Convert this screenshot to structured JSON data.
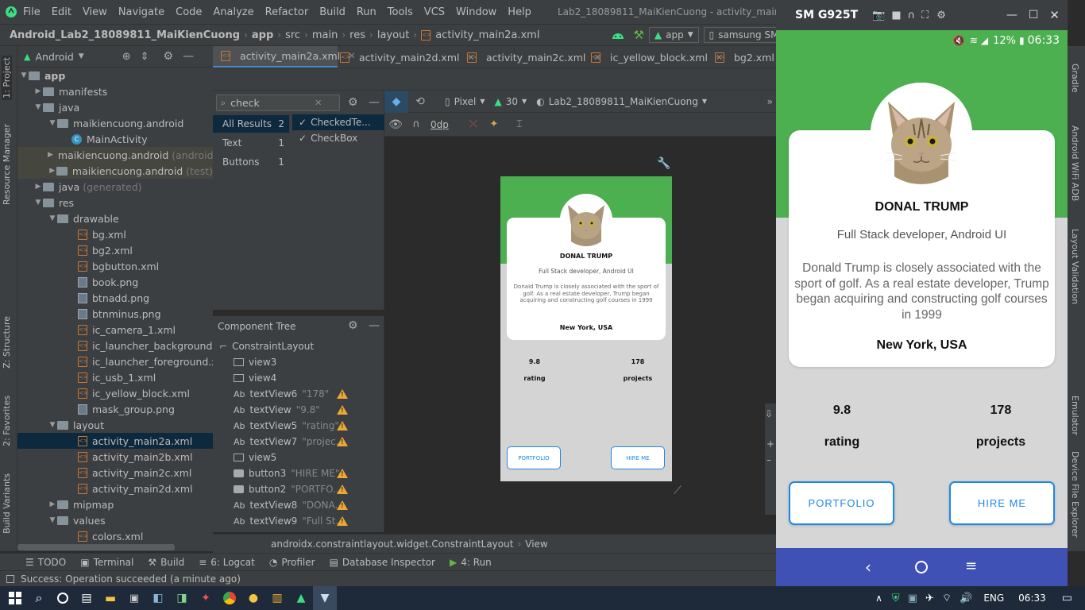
{
  "menu": [
    "File",
    "Edit",
    "View",
    "Navigate",
    "Code",
    "Analyze",
    "Refactor",
    "Build",
    "Run",
    "Tools",
    "VCS",
    "Window",
    "Help"
  ],
  "window_title": "Lab2_18089811_MaiKienCuong - activity_main2a.xml [Lab2_18089811_Mai",
  "breadcrumb": [
    "Android_Lab2_18089811_MaiKienCuong",
    "app",
    "src",
    "main",
    "res",
    "layout",
    "activity_main2a.xml"
  ],
  "run_config": "app",
  "device": "samsung SM-G925T",
  "left_tabs": [
    "1: Project",
    "Resource Manager",
    "Z: Structure",
    "2: Favorites",
    "Build Variants"
  ],
  "project": {
    "view_label": "Android",
    "tree": [
      {
        "label": "app",
        "suffix": "",
        "kind": "folder",
        "arrow": "▼"
      },
      {
        "label": "manifests",
        "suffix": "",
        "kind": "folder",
        "arrow": "▶"
      },
      {
        "label": "java",
        "suffix": "",
        "kind": "folder",
        "arrow": "▼"
      },
      {
        "label": "maikiencuong.android",
        "suffix": "",
        "kind": "folder",
        "arrow": "▼"
      },
      {
        "label": "MainActivity",
        "suffix": "",
        "kind": "class",
        "arrow": ""
      },
      {
        "label": "maikiencuong.android",
        "suffix": "(androidT",
        "kind": "folder",
        "arrow": "▶"
      },
      {
        "label": "maikiencuong.android",
        "suffix": "(test)",
        "kind": "folder",
        "arrow": "▶"
      },
      {
        "label": "java",
        "suffix": "(generated)",
        "kind": "folder",
        "arrow": "▶"
      },
      {
        "label": "res",
        "suffix": "",
        "kind": "folder",
        "arrow": "▼"
      },
      {
        "label": "drawable",
        "suffix": "",
        "kind": "folder",
        "arrow": "▼"
      },
      {
        "label": "bg.xml",
        "suffix": "",
        "kind": "xml",
        "arrow": ""
      },
      {
        "label": "bg2.xml",
        "suffix": "",
        "kind": "xml",
        "arrow": ""
      },
      {
        "label": "bgbutton.xml",
        "suffix": "",
        "kind": "xml",
        "arrow": ""
      },
      {
        "label": "book.png",
        "suffix": "",
        "kind": "png",
        "arrow": ""
      },
      {
        "label": "btnadd.png",
        "suffix": "",
        "kind": "png",
        "arrow": ""
      },
      {
        "label": "btnminus.png",
        "suffix": "",
        "kind": "png",
        "arrow": ""
      },
      {
        "label": "ic_camera_1.xml",
        "suffix": "",
        "kind": "xml",
        "arrow": ""
      },
      {
        "label": "ic_launcher_background.xml",
        "suffix": "",
        "kind": "xml",
        "arrow": ""
      },
      {
        "label": "ic_launcher_foreground.xml",
        "suffix": "(",
        "kind": "xml",
        "arrow": ""
      },
      {
        "label": "ic_usb_1.xml",
        "suffix": "",
        "kind": "xml",
        "arrow": ""
      },
      {
        "label": "ic_yellow_block.xml",
        "suffix": "",
        "kind": "xml",
        "arrow": ""
      },
      {
        "label": "mask_group.png",
        "suffix": "",
        "kind": "png",
        "arrow": ""
      },
      {
        "label": "layout",
        "suffix": "",
        "kind": "folder",
        "arrow": "▼"
      },
      {
        "label": "activity_main2a.xml",
        "suffix": "",
        "kind": "xml",
        "arrow": ""
      },
      {
        "label": "activity_main2b.xml",
        "suffix": "",
        "kind": "xml",
        "arrow": ""
      },
      {
        "label": "activity_main2c.xml",
        "suffix": "",
        "kind": "xml",
        "arrow": ""
      },
      {
        "label": "activity_main2d.xml",
        "suffix": "",
        "kind": "xml",
        "arrow": ""
      },
      {
        "label": "mipmap",
        "suffix": "",
        "kind": "folder",
        "arrow": "▶"
      },
      {
        "label": "values",
        "suffix": "",
        "kind": "folder",
        "arrow": "▼"
      },
      {
        "label": "colors.xml",
        "suffix": "",
        "kind": "xml",
        "arrow": ""
      }
    ]
  },
  "tabs": [
    "activity_main2a.xml",
    "activity_main2d.xml",
    "activity_main2c.xml",
    "ic_yellow_block.xml",
    "bg2.xml"
  ],
  "palette": {
    "search_value": "check",
    "categories": [
      {
        "label": "All Results",
        "count": "2"
      },
      {
        "label": "Text",
        "count": "1"
      },
      {
        "label": "Buttons",
        "count": "1"
      }
    ],
    "results": [
      "CheckedTe...",
      "CheckBox"
    ]
  },
  "component_tree": {
    "title": "Component Tree",
    "root": "ConstraintLayout",
    "nodes": [
      {
        "name": "view3",
        "value": "",
        "kind": "view",
        "warn": false
      },
      {
        "name": "view4",
        "value": "",
        "kind": "view",
        "warn": false
      },
      {
        "name": "textView6",
        "value": "\"178\"",
        "kind": "text",
        "warn": true
      },
      {
        "name": "textView",
        "value": "\"9.8\"",
        "kind": "text",
        "warn": true
      },
      {
        "name": "textView5",
        "value": "\"rating\"",
        "kind": "text",
        "warn": true
      },
      {
        "name": "textView7",
        "value": "\"projec...",
        "kind": "text",
        "warn": true
      },
      {
        "name": "view5",
        "value": "",
        "kind": "view",
        "warn": false
      },
      {
        "name": "button3",
        "value": "\"HIRE ME\"",
        "kind": "button",
        "warn": true
      },
      {
        "name": "button2",
        "value": "\"PORTFO...",
        "kind": "button",
        "warn": true
      },
      {
        "name": "textView8",
        "value": "\"DONA...",
        "kind": "text",
        "warn": true
      },
      {
        "name": "textView9",
        "value": "\"Full St...",
        "kind": "text",
        "warn": true
      }
    ]
  },
  "design_toolbar": {
    "device": "Pixel",
    "api": "30",
    "theme": "Lab2_18089811_MaiKienCuong",
    "margin": "0dp"
  },
  "layout_breadcrumb": [
    "androidx.constraintlayout.widget.ConstraintLayout",
    "View"
  ],
  "profile": {
    "name": "DONAL TRUMP",
    "role": "Full Stack developer, Android UI",
    "bio": "Donald Trump is closely associated with the sport of golf. As a real estate developer, Trump began acquiring and constructing golf courses in 1999",
    "location": "New York, USA",
    "rating_value": "9.8",
    "rating_label": "rating",
    "projects_value": "178",
    "projects_label": "projects",
    "btn_portfolio": "PORTFOLIO",
    "btn_hire": "HIRE ME"
  },
  "tool_windows": [
    "TODO",
    "Terminal",
    "Build",
    "6: Logcat",
    "Profiler",
    "Database Inspector",
    "4: Run"
  ],
  "status_text": "Success: Operation succeeded (a minute ago)",
  "right_tabs": [
    "Gradle",
    "Android WiFi ADB",
    "Layout Validation",
    "Emulator",
    "Device File Explorer"
  ],
  "emulator": {
    "device_name": "SM G925T",
    "battery": "12%",
    "time": "06:33"
  },
  "taskbar": {
    "lang": "ENG",
    "time": "06:33"
  },
  "colors": {
    "green": "#4caf50",
    "accent": "#1e88e5",
    "nav": "#3f51b5"
  }
}
